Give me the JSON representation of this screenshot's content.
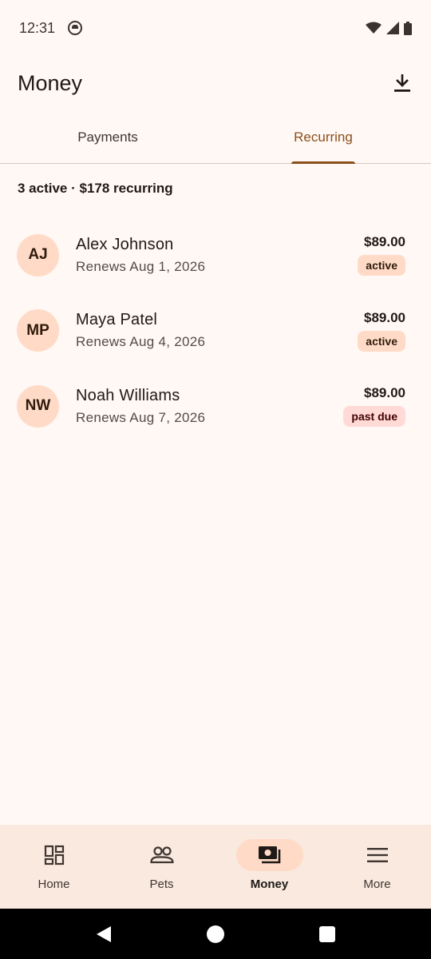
{
  "status_bar": {
    "time": "12:31",
    "icons": [
      "notification-icon",
      "wifi-icon",
      "signal-icon",
      "battery-icon"
    ]
  },
  "app_bar": {
    "title": "Money",
    "action_icon": "download-icon"
  },
  "tabs": [
    {
      "label": "Payments",
      "active": false
    },
    {
      "label": "Recurring",
      "active": true
    }
  ],
  "summary": "3 active · $178 recurring",
  "subscriptions": [
    {
      "initials": "AJ",
      "name": "Alex Johnson",
      "renews": "Renews Aug 1, 2026",
      "amount": "$89.00",
      "status": "active"
    },
    {
      "initials": "MP",
      "name": "Maya Patel",
      "renews": "Renews Aug 4, 2026",
      "amount": "$89.00",
      "status": "active"
    },
    {
      "initials": "NW",
      "name": "Noah Williams",
      "renews": "Renews Aug 7, 2026",
      "amount": "$89.00",
      "status": "past due"
    }
  ],
  "bottom_nav": [
    {
      "label": "Home",
      "icon": "dashboard-icon",
      "active": false
    },
    {
      "label": "Pets",
      "icon": "people-icon",
      "active": false
    },
    {
      "label": "Money",
      "icon": "payments-icon",
      "active": true
    },
    {
      "label": "More",
      "icon": "menu-icon",
      "active": false
    }
  ],
  "colors": {
    "background": "#fff8f4",
    "accent": "#8c4f1b",
    "avatar_bg": "#ffdbc7",
    "badge_active_bg": "#ffdbc7",
    "badge_past_due_bg": "#ffdad6",
    "nav_bg": "#f9e9df"
  }
}
